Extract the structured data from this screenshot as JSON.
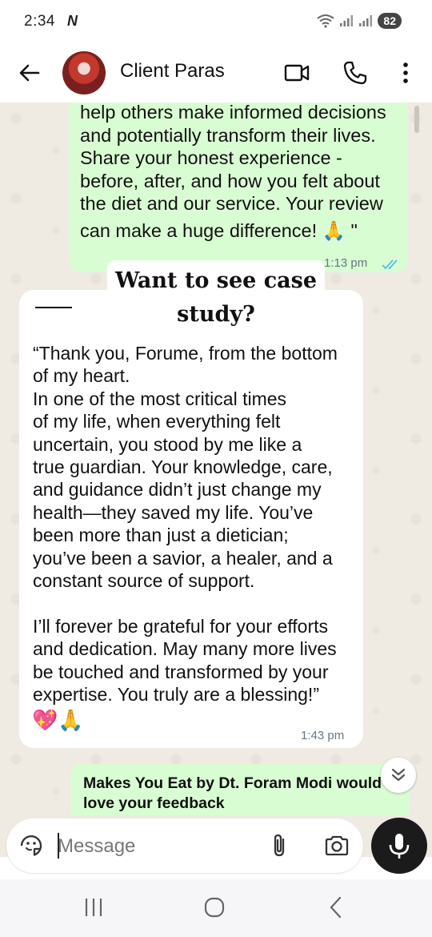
{
  "status_bar": {
    "time": "2:34",
    "carrier_glyph": "N",
    "battery": "82",
    "icons": [
      "wifi-icon",
      "signal-icon",
      "signal-icon"
    ]
  },
  "header": {
    "contact_name": "Client Paras",
    "icons": [
      "back-arrow-icon",
      "video-call-icon",
      "phone-icon",
      "more-vert-icon"
    ]
  },
  "messages": {
    "outgoing_1": {
      "lines": [
        "help others make informed decisions",
        "and potentially transform their lives.",
        "Share your honest experience -",
        "before, after, and how you felt about",
        "the diet and our service. Your review"
      ],
      "last_line": "can make a huge difference! 🙏 \"",
      "time": "1:13 pm"
    },
    "sticker": {
      "line1": "Want to see case",
      "line2": "study?"
    },
    "incoming_1": {
      "text": "“Thank you, Forume, from the bottom\nof my heart.\nIn one of the most critical times\nof my life, when everything felt\nuncertain, you stood by me like a\ntrue guardian. Your knowledge, care,\nand guidance didn’t just change my\nhealth—they saved my life. You’ve\nbeen more than just a dietician;\nyou’ve been a savior, a healer, and a\nconstant source of support.\n\nI’ll forever be grateful for your efforts\nand dedication. May many more lives\nbe touched and transformed by your\nexpertise. You truly are a blessing!”",
      "emoji": "💖🙏",
      "time": "1:43 pm"
    },
    "outgoing_2": {
      "line1": "Makes You Eat by Dt. Foram Modi would",
      "line2": "love your feedback"
    }
  },
  "input": {
    "placeholder": "Message",
    "value": ""
  },
  "colors": {
    "outgoing_bubble": "#d9fdd3",
    "chat_background": "#efeae2",
    "read_ticks": "#53bdeb",
    "mic_button": "#1b1b1b"
  }
}
